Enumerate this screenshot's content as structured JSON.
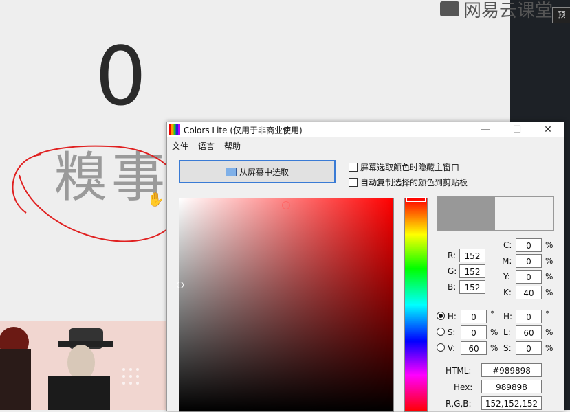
{
  "background": {
    "big_number": "0",
    "big_chars": "糗事",
    "watermark": "网易云课堂",
    "corner_button": "预"
  },
  "window": {
    "title": "Colors Lite (仅用于非商业使用)",
    "controls": {
      "minimize": "—",
      "maximize": "☐",
      "close": "✕"
    },
    "menu": [
      "文件",
      "语言",
      "帮助"
    ],
    "pick_button": "从屏幕中选取",
    "options": [
      {
        "label": "屏幕选取颜色时隐藏主窗口",
        "checked": false
      },
      {
        "label": "自动复制选择的颜色到剪贴板",
        "checked": false
      }
    ],
    "preview_color": "#989898",
    "rgb": {
      "R": "152",
      "G": "152",
      "B": "152"
    },
    "cmyk": {
      "C": "0",
      "M": "0",
      "Y": "0",
      "K": "40"
    },
    "hsv": {
      "H": "0",
      "S": "0",
      "V": "60",
      "selected": "H"
    },
    "hsl": {
      "H": "0",
      "L": "60",
      "S": "0"
    },
    "units": {
      "percent": "%",
      "degree": "°"
    },
    "html_label": "HTML:",
    "html_value": "#989898",
    "hex_label": "Hex:",
    "hex_value": "989898",
    "rgb_label": "R,G,B:",
    "rgb_value": "152,152,152"
  }
}
